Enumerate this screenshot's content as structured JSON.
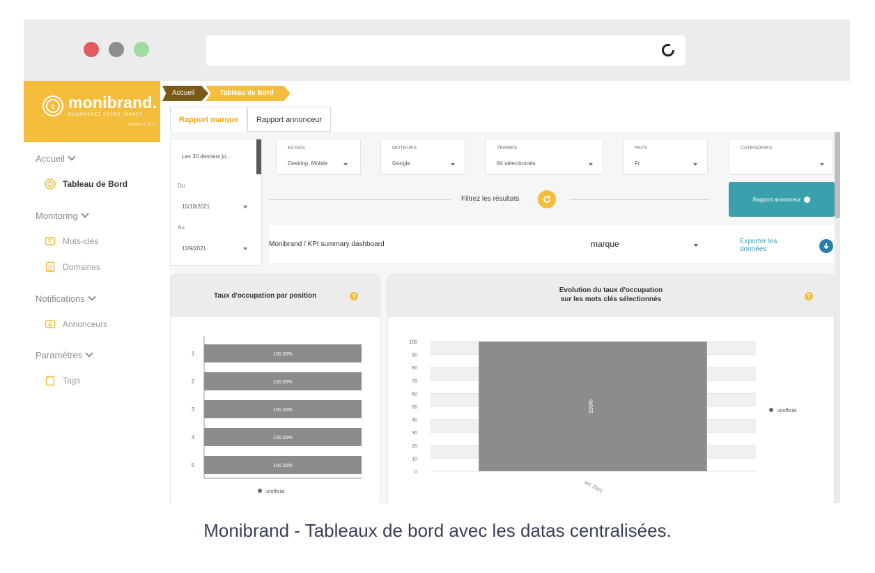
{
  "browser": {
    "window_controls": [
      "close",
      "minimize",
      "maximize"
    ],
    "reload_icon": "reload-icon"
  },
  "sidebar": {
    "brand_name": "monibrand.",
    "brand_tagline": "COMPRENEZ VOTRE IMPACT",
    "brand_version": "version 2.10.0",
    "sections": [
      {
        "label": "Accueil",
        "items": [
          {
            "label": "Tableau de Bord",
            "icon": "dashboard-icon",
            "active": true
          }
        ]
      },
      {
        "label": "Monitoring",
        "items": [
          {
            "label": "Mots-clés",
            "icon": "keyword-icon"
          },
          {
            "label": "Domaines",
            "icon": "domain-icon"
          }
        ]
      },
      {
        "label": "Notifications",
        "items": [
          {
            "label": "Annonceurs",
            "icon": "advertiser-icon"
          }
        ]
      },
      {
        "label": "Paramètres",
        "items": [
          {
            "label": "Tags",
            "icon": "tag-icon"
          }
        ]
      }
    ]
  },
  "breadcrumb": {
    "home": "Accueil",
    "current": "Tableau de Bord"
  },
  "tabs": [
    {
      "label": "Rapport marque",
      "active": true
    },
    {
      "label": "Rapport annonceur",
      "active": false
    }
  ],
  "date_panel": {
    "range": "Les 30 derniers jo...",
    "from_label": "Du",
    "from_value": "10/10/2021",
    "to_label": "Au",
    "to_value": "11/9/2021"
  },
  "filters": [
    {
      "label": "ECRAN",
      "value": "Desktop, Mobile"
    },
    {
      "label": "MOTEURS",
      "value": "Google"
    },
    {
      "label": "TERMES",
      "value": "84 sélectionnés"
    },
    {
      "label": "PAYS",
      "value": "Fr"
    },
    {
      "label": "CATEGORIES",
      "value": ""
    }
  ],
  "filter_results_label": "Filtrez les résultats",
  "report_button": "Rapport annonceur",
  "kpi": {
    "title": "Monibrand / KPI summary dashboard",
    "select_value": "marque",
    "export_label": "Exporter les données"
  },
  "colors": {
    "brand": "#f4bd3c",
    "teal": "#3aa0ac",
    "bar": "#8c8c8c",
    "breadcrumb_dark": "#7a5a18"
  },
  "chart_data": [
    {
      "type": "bar",
      "orientation": "horizontal",
      "title": "Taux d'occupation par position",
      "categories": [
        "1",
        "2",
        "3",
        "4",
        "5"
      ],
      "series": [
        {
          "name": "unofficial",
          "values": [
            100,
            100,
            100,
            100,
            100
          ]
        }
      ],
      "data_labels": [
        "100.00%",
        "100.00%",
        "100.00%",
        "100.00%",
        "100.00%"
      ],
      "legend": "bottom"
    },
    {
      "type": "bar",
      "title_line1": "Evolution du taux d'occupation",
      "title_line2": "sur les mots clés sélectionnés",
      "categories": [
        "oct. 2021"
      ],
      "series": [
        {
          "name": "unofficial",
          "values": [
            100
          ]
        }
      ],
      "data_labels": [
        "100%"
      ],
      "yticks": [
        "0",
        "10",
        "20",
        "30",
        "40",
        "50",
        "60",
        "70",
        "80",
        "90",
        "100"
      ],
      "ylim": [
        0,
        100
      ],
      "grid": true,
      "legend": "right"
    }
  ],
  "caption": "Monibrand - Tableaux de bord avec les datas centralisées."
}
